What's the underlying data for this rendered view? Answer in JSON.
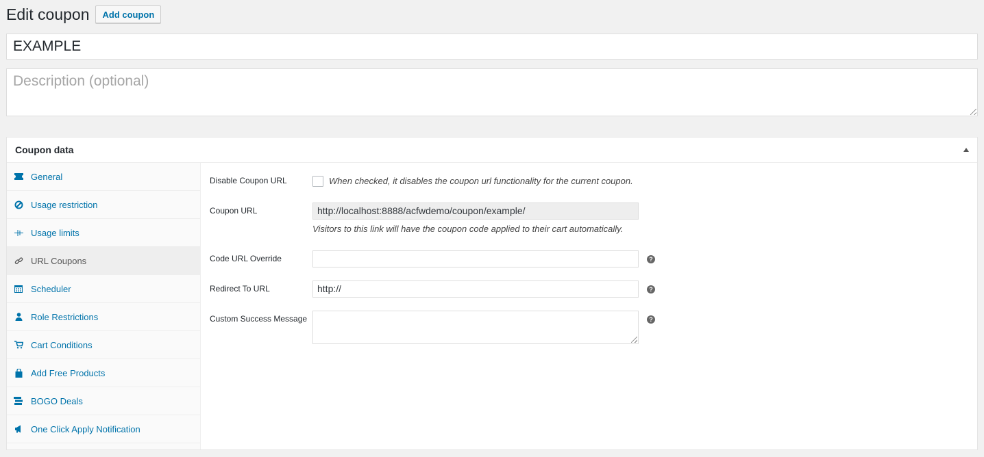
{
  "header": {
    "title": "Edit coupon",
    "add_button": "Add coupon"
  },
  "coupon": {
    "code": "EXAMPLE",
    "description_placeholder": "Description (optional)"
  },
  "panel": {
    "title": "Coupon data",
    "tabs": [
      {
        "label": "General",
        "icon": "ticket-icon"
      },
      {
        "label": "Usage restriction",
        "icon": "no-entry-icon"
      },
      {
        "label": "Usage limits",
        "icon": "limits-icon"
      },
      {
        "label": "URL Coupons",
        "icon": "link-icon"
      },
      {
        "label": "Scheduler",
        "icon": "calendar-icon"
      },
      {
        "label": "Role Restrictions",
        "icon": "user-icon"
      },
      {
        "label": "Cart Conditions",
        "icon": "cart-icon"
      },
      {
        "label": "Add Free Products",
        "icon": "bag-icon"
      },
      {
        "label": "BOGO Deals",
        "icon": "stack-icon"
      },
      {
        "label": "One Click Apply Notification",
        "icon": "megaphone-icon"
      }
    ],
    "active_tab": "URL Coupons"
  },
  "url_coupons": {
    "disable_label": "Disable Coupon URL",
    "disable_help": "When checked, it disables the coupon url functionality for the current coupon.",
    "disable_checked": false,
    "coupon_url_label": "Coupon URL",
    "coupon_url_value": "http://localhost:8888/acfwdemo/coupon/example/",
    "coupon_url_help": "Visitors to this link will have the coupon code applied to their cart automatically.",
    "code_override_label": "Code URL Override",
    "code_override_value": "",
    "redirect_label": "Redirect To URL",
    "redirect_placeholder": "http://",
    "success_label": "Custom Success Message",
    "success_value": ""
  }
}
